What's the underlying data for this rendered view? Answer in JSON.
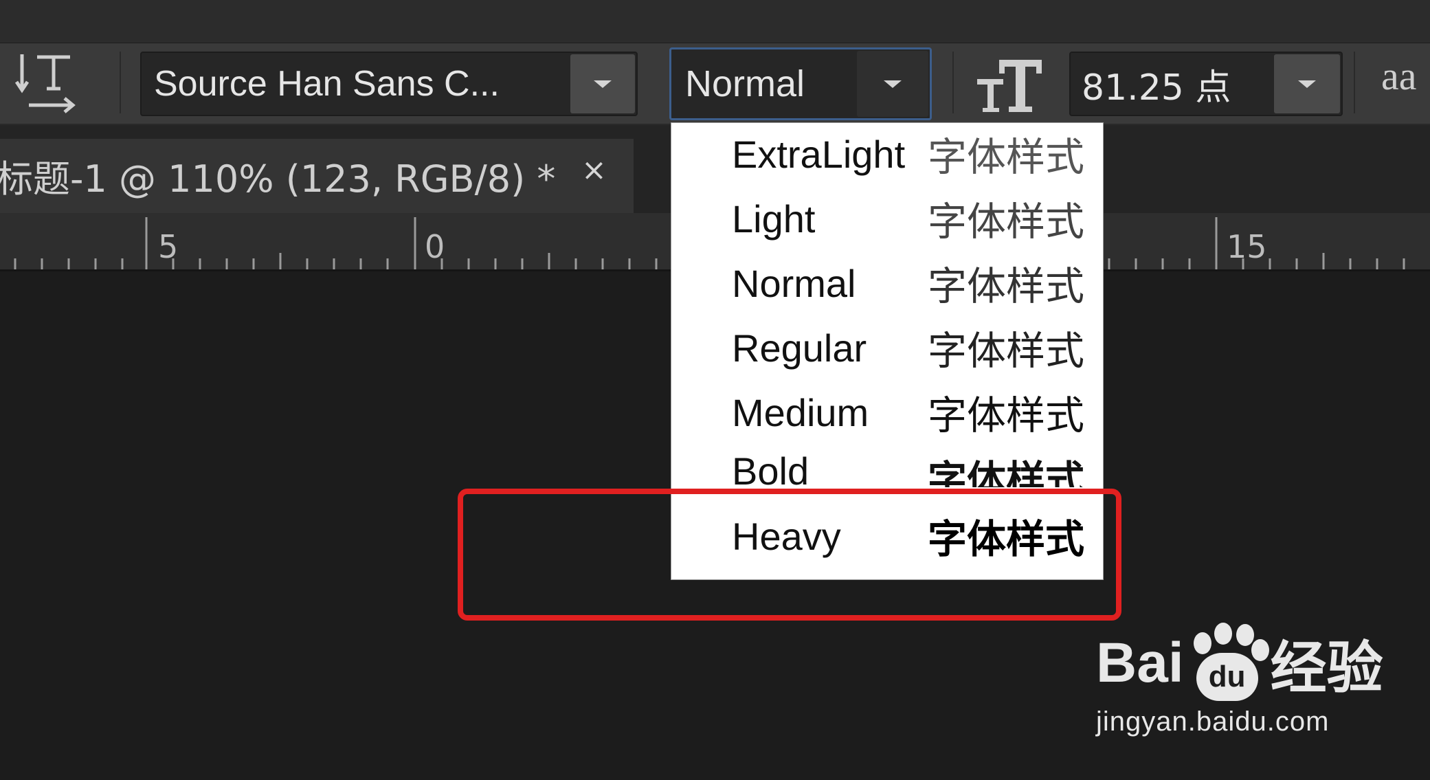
{
  "options_bar": {
    "text_orientation_icon": "toggle-text-orientation-icon",
    "font_family": {
      "value": "Source Han Sans C..."
    },
    "font_style": {
      "value": "Normal"
    },
    "font_size_icon": "font-size-icon",
    "font_size": {
      "value": "81.25 点"
    },
    "anti_alias_icon_text": "aa"
  },
  "document_tab": {
    "title": "标题-1 @ 110% (123, RGB/8) *",
    "close_label": "×"
  },
  "ruler": {
    "labels": [
      "5",
      "0",
      "15"
    ]
  },
  "font_style_dropdown": {
    "sample_text": "字体样式",
    "items": [
      {
        "name": "ExtraLight",
        "sample": "字体样式"
      },
      {
        "name": "Light",
        "sample": "字体样式"
      },
      {
        "name": "Normal",
        "sample": "字体样式"
      },
      {
        "name": "Regular",
        "sample": "字体样式"
      },
      {
        "name": "Medium",
        "sample": "字体样式"
      },
      {
        "name": "Bold",
        "sample": "字体样式"
      },
      {
        "name": "Heavy",
        "sample": "字体样式"
      }
    ]
  },
  "annotation": {
    "color": "#e02020"
  },
  "watermark": {
    "logo_left": "Bai",
    "logo_paw": "du",
    "logo_right": "经验",
    "url": "jingyan.baidu.com"
  },
  "colors": {
    "app_background": "#1c1c1c",
    "options_bar": "#3a3a3a",
    "dropdown_background": "#ffffff",
    "highlight": "#e02020"
  }
}
